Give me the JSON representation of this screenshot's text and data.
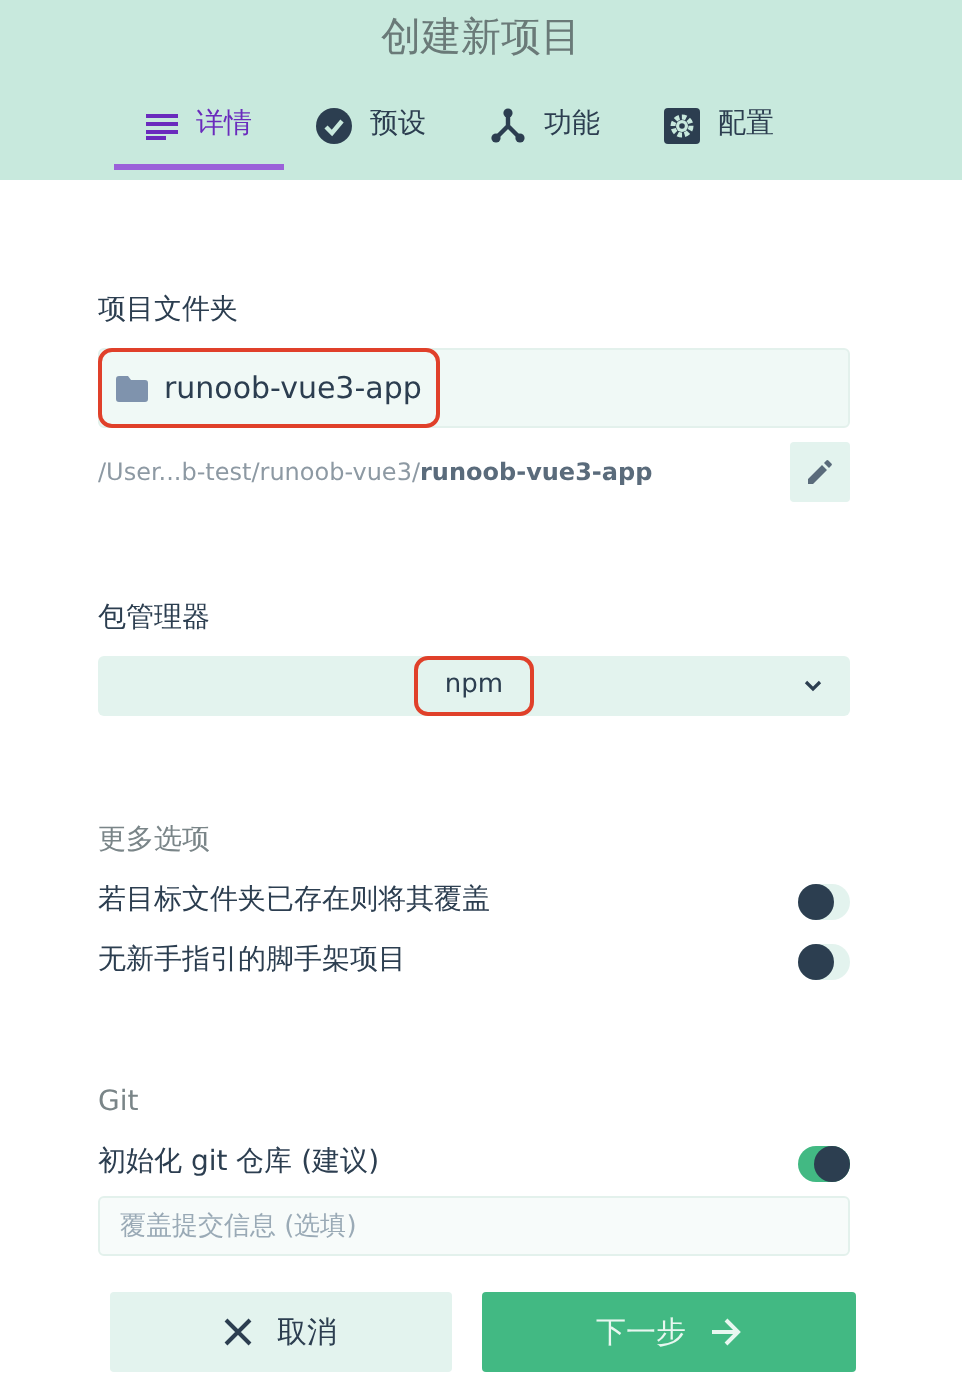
{
  "title": "创建新项目",
  "tabs": [
    {
      "kind": "details",
      "label": "详情",
      "selected": true
    },
    {
      "kind": "presets",
      "label": "预设",
      "selected": false
    },
    {
      "kind": "features",
      "label": "功能",
      "selected": false
    },
    {
      "kind": "config",
      "label": "配置",
      "selected": false
    }
  ],
  "folder": {
    "label": "项目文件夹",
    "value": "runoob-vue3-app",
    "highlighted": true,
    "path_prefix": "/User...b-test/runoob-vue3/",
    "path_name": "runoob-vue3-app"
  },
  "package_manager": {
    "label": "包管理器",
    "value": "npm",
    "highlighted": true
  },
  "more_options": {
    "label": "更多选项",
    "toggles": [
      {
        "label": "若目标文件夹已存在则将其覆盖",
        "on": false
      },
      {
        "label": "无新手指引的脚手架项目",
        "on": false
      }
    ]
  },
  "git": {
    "label": "Git",
    "toggles": [
      {
        "label": "初始化 git 仓库 (建议)",
        "on": true
      }
    ],
    "placeholder": "覆盖提交信息 (选填)"
  },
  "buttons": [
    {
      "kind": "cancel",
      "label": "取消"
    },
    {
      "kind": "next",
      "label": "下一步"
    }
  ]
}
